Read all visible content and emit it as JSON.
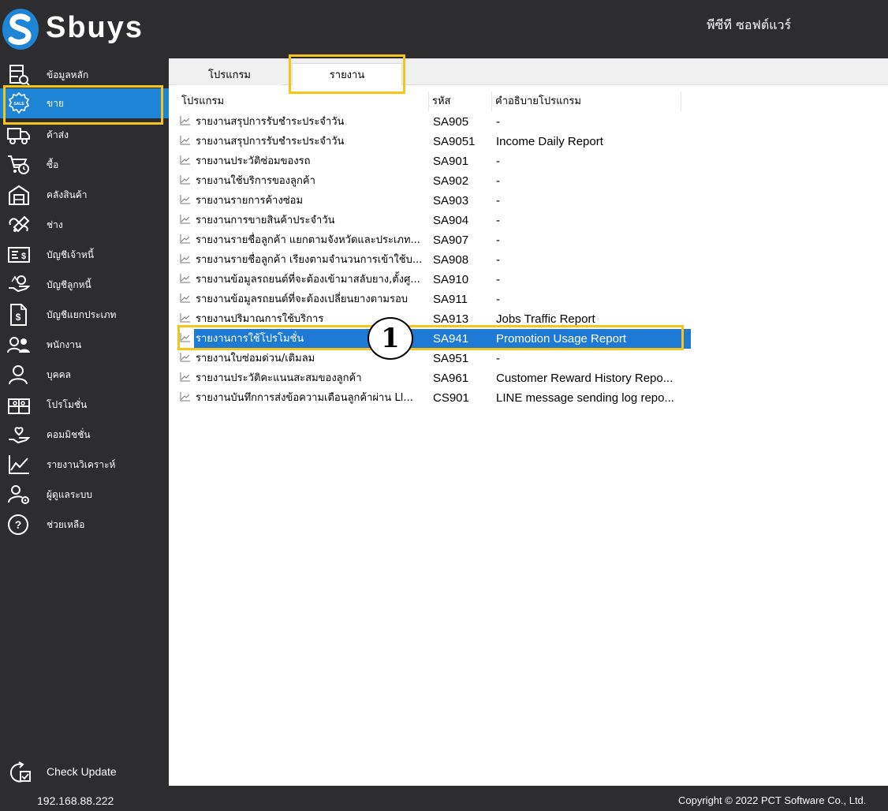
{
  "app": {
    "brand": "Sbuys",
    "company": "พีซีที ซอฟต์แวร์"
  },
  "sidebar": {
    "items": [
      {
        "label": "ข้อมูลหลัก",
        "icon": "master-data-icon"
      },
      {
        "label": "ขาย",
        "icon": "sale-badge-icon"
      },
      {
        "label": "ค้าส่ง",
        "icon": "truck-icon"
      },
      {
        "label": "ซื้อ",
        "icon": "cart-icon"
      },
      {
        "label": "คลังสินค้า",
        "icon": "warehouse-icon"
      },
      {
        "label": "ช่าง",
        "icon": "wrench-icon"
      },
      {
        "label": "บัญชีเจ้าหนี้",
        "icon": "invoice-icon"
      },
      {
        "label": "บัญชีลูกหนี้",
        "icon": "receivable-icon"
      },
      {
        "label": "บัญชีแยกประเภท",
        "icon": "ledger-icon"
      },
      {
        "label": "พนักงาน",
        "icon": "employees-icon"
      },
      {
        "label": "บุคคล",
        "icon": "person-icon"
      },
      {
        "label": "โปรโมชั่น",
        "icon": "gift-icon"
      },
      {
        "label": "คอมมิชชั่น",
        "icon": "commission-icon"
      },
      {
        "label": "รายงานวิเคราะห์",
        "icon": "chart-icon"
      },
      {
        "label": "ผู้ดูแลระบบ",
        "icon": "admin-icon"
      },
      {
        "label": "ช่วยเหลือ",
        "icon": "help-icon"
      }
    ],
    "active_index": 1,
    "check_update": "Check Update",
    "ip": "192.168.88.222"
  },
  "tabs": {
    "program": "โปรแกรม",
    "report": "รายงาน"
  },
  "table": {
    "headers": {
      "name": "โปรแกรม",
      "code": "รหัส",
      "desc": "คำอธิบายโปรแกรม"
    },
    "rows": [
      {
        "name": "รายงานสรุปการรับชำระประจำวัน",
        "code": "SA905",
        "desc": "-"
      },
      {
        "name": "รายงานสรุปการรับชำระประจำวัน",
        "code": "SA9051",
        "desc": "Income Daily Report"
      },
      {
        "name": "รายงานประวัติซ่อมของรถ",
        "code": "SA901",
        "desc": "-"
      },
      {
        "name": "รายงานใช้บริการของลูกค้า",
        "code": "SA902",
        "desc": "-"
      },
      {
        "name": "รายงานรายการค้างซ่อม",
        "code": "SA903",
        "desc": "-"
      },
      {
        "name": "รายงานการขายสินค้าประจำวัน",
        "code": "SA904",
        "desc": "-"
      },
      {
        "name": "รายงานรายชื่อลูกค้า แยกตามจังหวัดและประเภท...",
        "code": "SA907",
        "desc": "-"
      },
      {
        "name": "รายงานรายชื่อลูกค้า เรียงตามจำนวนการเข้าใช้บ...",
        "code": "SA908",
        "desc": "-"
      },
      {
        "name": "รายงานข้อมูลรถยนต์ที่จะต้องเข้ามาสลับยาง,ตั้งศู...",
        "code": "SA910",
        "desc": "-"
      },
      {
        "name": "รายงานข้อมูลรถยนต์ที่จะต้องเปลี่ยนยางตามรอบ",
        "code": "SA911",
        "desc": "-"
      },
      {
        "name": "รายงานปริมาณการใช้บริการ",
        "code": "SA913",
        "desc": "Jobs Traffic Report"
      },
      {
        "name": "รายงานการใช้โปรโมชั่น",
        "code": "SA941",
        "desc": "Promotion Usage Report"
      },
      {
        "name": "รายงานใบซ่อมด่วน/เติมลม",
        "code": "SA951",
        "desc": "-"
      },
      {
        "name": "รายงานประวัติคะแนนสะสมของลูกค้า",
        "code": "SA961",
        "desc": "Customer Reward History Repo..."
      },
      {
        "name": "รายงานบันทึกการส่งข้อความเตือนลูกค้าผ่าน LI...",
        "code": "CS901",
        "desc": "LINE message sending log repo..."
      }
    ],
    "selected_index": 11
  },
  "callout": {
    "number": "1"
  },
  "footer": {
    "copyright": "Copyright © 2022 PCT Software Co., Ltd."
  },
  "colors": {
    "sidebar_bg": "#2d2d30",
    "active": "#1e84d6",
    "selection": "#1e7ad4",
    "highlight": "#f5c518"
  }
}
